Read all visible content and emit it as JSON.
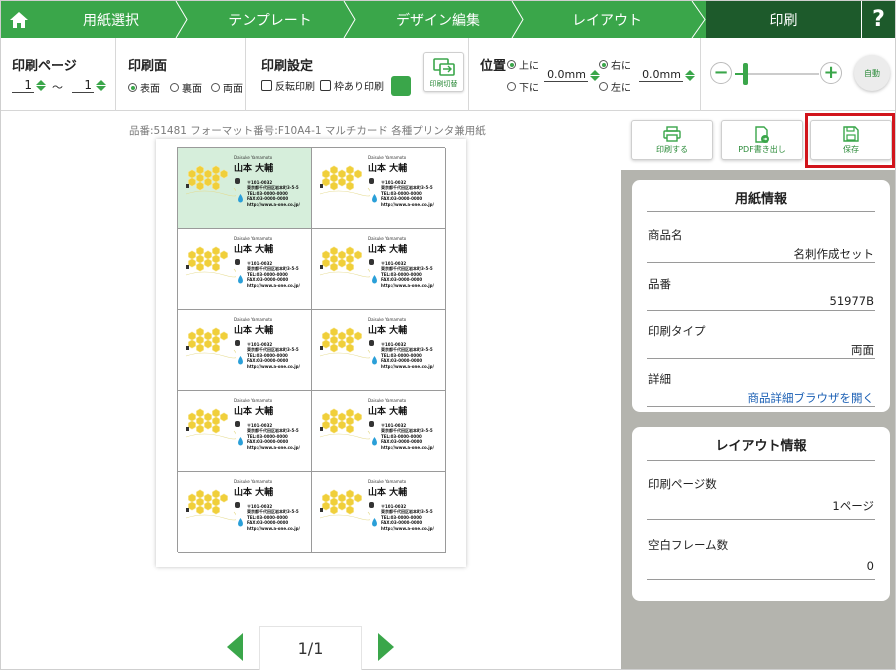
{
  "nav": {
    "steps": [
      "用紙選択",
      "テンプレート",
      "デザイン編集",
      "レイアウト",
      "印刷"
    ],
    "active_step": "印刷",
    "help": "?",
    "colors": {
      "green": "#3aa64a",
      "dark_green": "#1d5a2b"
    }
  },
  "toolbar": {
    "print_page": {
      "title": "印刷ページ",
      "from": "1",
      "tilde": "〜",
      "to": "1"
    },
    "print_side": {
      "title": "印刷面",
      "options": [
        "表面",
        "裏面",
        "両面"
      ],
      "selected": "表面"
    },
    "print_settings": {
      "title": "印刷設定",
      "reverse": "反転印刷",
      "frame": "枠あり印刷",
      "swap": "印刷切替"
    },
    "position": {
      "title": "位置",
      "vertical": [
        "上に",
        "下に"
      ],
      "vertical_selected": "上に",
      "vertical_value": "0.0mm",
      "horizontal": [
        "右に",
        "左に"
      ],
      "horizontal_selected": "右に",
      "horizontal_value": "0.0mm"
    },
    "zoom": {
      "minus": "−",
      "plus": "+",
      "auto": "自動",
      "level": 0.12
    }
  },
  "preview": {
    "product_line": "品番:51481 フォーマット番号:F10A4-1 マルチカード 各種プリンタ兼用紙",
    "card": {
      "name_en": "Daisuke Yamamoto",
      "name_jp": "山本 大輔",
      "address": "〒101-0032\n東京都千代田区岩本町3-5-5\nTEL:03-0000-0000\nFAX:03-0000-0000\nhttp://www.a-one.co.jp/"
    },
    "page": "1/1"
  },
  "actions": {
    "print": "印刷する",
    "pdf": "PDF書き出し",
    "save": "保存"
  },
  "paper_info": {
    "title": "用紙情報",
    "product_name_label": "商品名",
    "product_name": "名刺作成セット",
    "product_no_label": "品番",
    "product_no": "51977B",
    "print_type_label": "印刷タイプ",
    "print_type": "両面",
    "detail_label": "詳細",
    "detail_link": "商品詳細ブラウザを開く"
  },
  "layout_info": {
    "title": "レイアウト情報",
    "pages_label": "印刷ページ数",
    "pages": "1ページ",
    "blank_label": "空白フレーム数",
    "blank": "0"
  }
}
